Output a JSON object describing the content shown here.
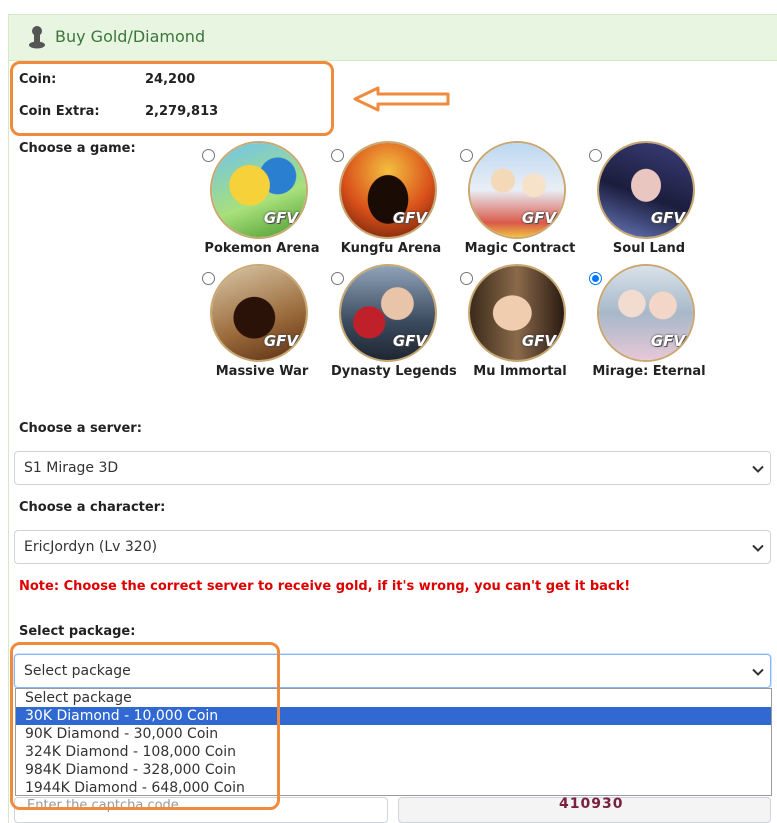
{
  "header": {
    "title": "Buy Gold/Diamond",
    "icon": "user-icon"
  },
  "account": {
    "coin_label": "Coin:",
    "coin_value": "24,200",
    "coin_extra_label": "Coin Extra:",
    "coin_extra_value": "2,279,813"
  },
  "games": {
    "label": "Choose a game:",
    "badge": "GFV",
    "items": [
      {
        "name": "Pokemon Arena",
        "selected": false
      },
      {
        "name": "Kungfu Arena",
        "selected": false
      },
      {
        "name": "Magic Contract",
        "selected": false
      },
      {
        "name": "Soul Land",
        "selected": false
      },
      {
        "name": "Massive War",
        "selected": false
      },
      {
        "name": "Dynasty Legends",
        "selected": false
      },
      {
        "name": "Mu Immortal",
        "selected": false
      },
      {
        "name": "Mirage: Eternal",
        "selected": true
      }
    ]
  },
  "server": {
    "label": "Choose a server:",
    "value": "S1 Mirage 3D"
  },
  "character": {
    "label": "Choose a character:",
    "value": "EricJordyn (Lv 320)"
  },
  "note": "Note: Choose the correct server to receive gold, if it's wrong, you can't get it back!",
  "package": {
    "label": "Select package:",
    "value": "Select package",
    "options": [
      "Select package",
      "30K Diamond - 10,000 Coin",
      "90K Diamond - 30,000 Coin",
      "324K Diamond - 108,000 Coin",
      "984K Diamond - 328,000 Coin",
      "1944K Diamond - 648,000 Coin"
    ],
    "highlighted_index": 1
  },
  "captcha": {
    "placeholder": "Enter the captcha code",
    "code": "410930"
  },
  "colors": {
    "annotation": "#f08a3c",
    "note": "#dd0000",
    "highlight": "#3069d1",
    "header_bg": "#e8f5e0"
  }
}
